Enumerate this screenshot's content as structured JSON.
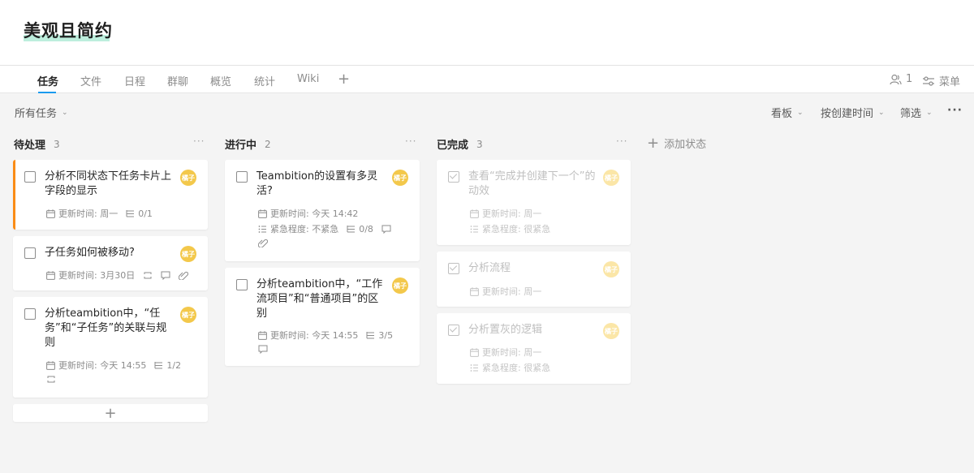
{
  "header": {
    "title": "美观且简约"
  },
  "tabs": [
    {
      "label": "任务"
    },
    {
      "label": "文件"
    },
    {
      "label": "日程"
    },
    {
      "label": "群聊"
    },
    {
      "label": "概览"
    },
    {
      "label": "统计"
    },
    {
      "label": "Wiki"
    }
  ],
  "tab_add_icon": "+",
  "toolbar_right": {
    "members_count": "1",
    "menu_label": "菜单"
  },
  "filter": {
    "all_tasks": "所有任务",
    "view": "看板",
    "sort": "按创建时间",
    "filter": "筛选"
  },
  "avatar_text": "橘子",
  "colors": {
    "accent_bar": "#fa8c16",
    "avatar": "#f3c84b",
    "tab_indicator": "#1b9aee",
    "title_highlight": "#bdeedd"
  },
  "columns": [
    {
      "name": "待处理",
      "count": "3",
      "cards": [
        {
          "title": "分析不同状态下任务卡片上字段的显示",
          "updated": "更新时间: 周一",
          "subtasks": "0/1"
        },
        {
          "title": "子任务如何被移动?",
          "updated": "更新时间: 3月30日"
        },
        {
          "title": "分析teambition中，“任务”和“子任务”的关联与规则",
          "updated": "更新时间: 今天 14:55",
          "subtasks": "1/2"
        }
      ]
    },
    {
      "name": "进行中",
      "count": "2",
      "cards": [
        {
          "title": "Teambition的设置有多灵活?",
          "updated": "更新时间: 今天 14:42",
          "urgency": "紧急程度: 不紧急",
          "subtasks": "0/8"
        },
        {
          "title": "分析teambition中，“工作流项目”和“普通项目”的区别",
          "updated": "更新时间: 今天 14:55",
          "subtasks": "3/5"
        }
      ]
    },
    {
      "name": "已完成",
      "count": "3",
      "cards": [
        {
          "title": "查看“完成并创建下一个”的动效",
          "updated": "更新时间: 周一",
          "urgency": "紧急程度: 很紧急"
        },
        {
          "title": "分析流程",
          "updated": "更新时间: 周一"
        },
        {
          "title": "分析置灰的逻辑",
          "updated": "更新时间: 周一",
          "urgency": "紧急程度: 很紧急"
        }
      ]
    }
  ],
  "add_status_label": "添加状态"
}
